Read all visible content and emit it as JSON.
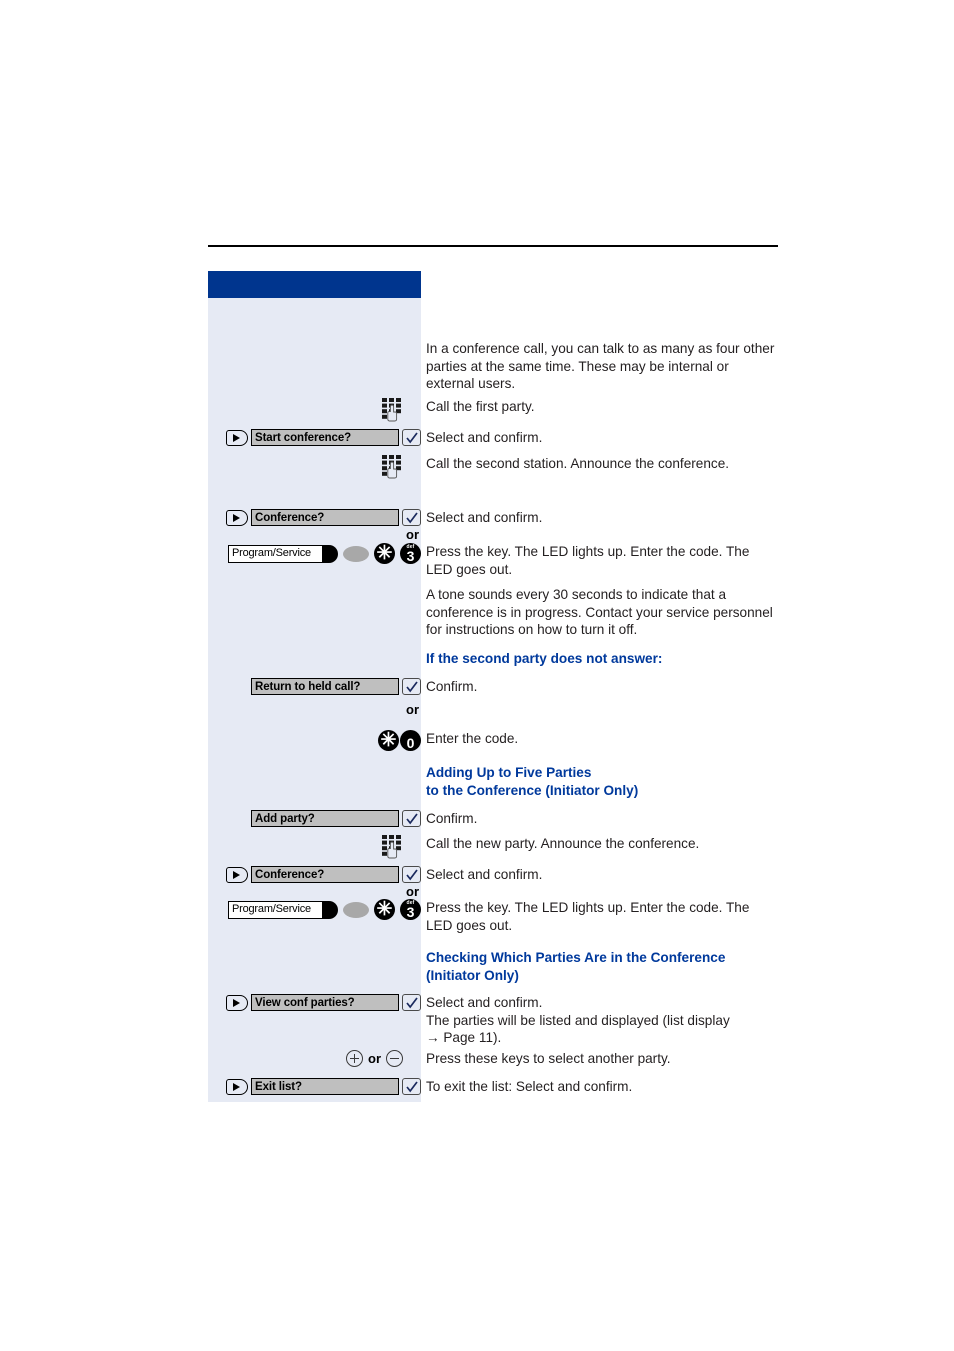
{
  "document": {
    "type": "telephone-user-guide-page",
    "colors": {
      "header_blue": "#00358e",
      "panel_background": "#e6eaf4",
      "heading_blue": "#00399c",
      "menu_box_grey": "#bfbfbf"
    }
  },
  "panel": {
    "header_title": ""
  },
  "intro": {
    "paragraph": "In a conference call, you can talk to as many as four other parties at the same time. These may be internal or external users."
  },
  "steps": [
    {
      "id": "call-first-party",
      "control": "dial-keypad",
      "description": "Call the first party."
    },
    {
      "id": "start-conference",
      "control": "menu-option",
      "has_arrow_key": true,
      "menu_label": "Start conference?",
      "description": "Select and confirm."
    },
    {
      "id": "call-second-station",
      "control": "dial-keypad",
      "description": "Call the second station. Announce the conference."
    },
    {
      "id": "conference-1",
      "control": "menu-option",
      "has_arrow_key": true,
      "menu_label": "Conference?",
      "description": "Select and confirm.",
      "or_label": "or"
    },
    {
      "id": "program-service-1",
      "control": "program-service-key",
      "key_label": "Program/Service",
      "code_keys": [
        {
          "glyph": "✳",
          "sub": ""
        },
        {
          "glyph": "3",
          "sub": "def"
        }
      ],
      "description": "Press the key. The LED lights up. Enter the code. The LED goes out."
    },
    {
      "id": "tone-note",
      "control": "none",
      "description": "A tone sounds every 30 seconds to indicate that a conference is in progress. Contact your service personnel for instructions on how to turn it off."
    },
    {
      "id": "heading-no-answer",
      "control": "none",
      "heading": "If the second party does not answer:"
    },
    {
      "id": "return-to-held-call",
      "control": "menu-option",
      "has_arrow_key": false,
      "menu_label": "Return to held call?",
      "description": "Confirm.",
      "or_label": "or"
    },
    {
      "id": "enter-code-star-0",
      "control": "number-keys",
      "code_keys": [
        {
          "glyph": "✳",
          "sub": ""
        },
        {
          "glyph": "0",
          "sub": ""
        }
      ],
      "description": "Enter the code."
    },
    {
      "id": "heading-adding-parties",
      "control": "none",
      "heading_line1": "Adding Up to Five Parties",
      "heading_line2": "to the Conference (Initiator Only)"
    },
    {
      "id": "add-party",
      "control": "menu-option",
      "has_arrow_key": false,
      "menu_label": "Add party?",
      "description": "Confirm."
    },
    {
      "id": "call-new-party",
      "control": "dial-keypad",
      "description": "Call the new party. Announce the conference."
    },
    {
      "id": "conference-2",
      "control": "menu-option",
      "has_arrow_key": true,
      "menu_label": "Conference?",
      "description": "Select and confirm.",
      "or_label": "or"
    },
    {
      "id": "program-service-2",
      "control": "program-service-key",
      "key_label": "Program/Service",
      "code_keys": [
        {
          "glyph": "✳",
          "sub": ""
        },
        {
          "glyph": "3",
          "sub": "def"
        }
      ],
      "description": "Press the key. The LED lights up. Enter the code. The LED goes out."
    },
    {
      "id": "heading-checking-parties",
      "control": "none",
      "heading_line1": "Checking Which Parties Are in the Conference",
      "heading_line2": "(Initiator Only)"
    },
    {
      "id": "view-conf-parties",
      "control": "menu-option",
      "has_arrow_key": true,
      "menu_label": "View conf parties?",
      "description_line1": "Select and confirm.",
      "description_line2": "The parties will be listed and displayed (list display",
      "description_line3": "→ Page 11)."
    },
    {
      "id": "plus-minus-keys",
      "control": "plus-minus",
      "plus_label": "+",
      "or_label": "or",
      "minus_label": "−",
      "description": "Press these keys to select another party."
    },
    {
      "id": "exit-list",
      "control": "menu-option",
      "has_arrow_key": true,
      "menu_label": "Exit list?",
      "description": "To exit the list: Select and confirm."
    }
  ]
}
